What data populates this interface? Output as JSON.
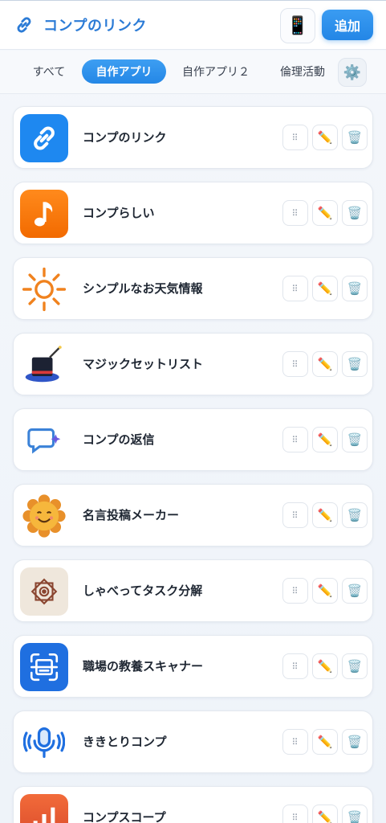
{
  "header": {
    "title": "コンプのリンク",
    "brand_icon": "link-icon",
    "device_icon": "mobile-phone-icon",
    "add_label": "追加"
  },
  "tabs": [
    {
      "label": "すべて",
      "active": false
    },
    {
      "label": "自作アプリ",
      "active": true
    },
    {
      "label": "自作アプリ２",
      "active": false
    },
    {
      "label": "倫理活動",
      "active": false
    }
  ],
  "tab_settings_icon": "gear-icon",
  "apps": [
    {
      "name": "コンプのリンク",
      "icon": "link-icon"
    },
    {
      "name": "コンプらしい",
      "icon": "music-note-icon"
    },
    {
      "name": "シンプルなお天気情報",
      "icon": "sun-icon"
    },
    {
      "name": "マジックセットリスト",
      "icon": "magic-hat-icon"
    },
    {
      "name": "コンプの返信",
      "icon": "chat-sparkle-icon"
    },
    {
      "name": "名言投稿メーカー",
      "icon": "smiling-flower-icon"
    },
    {
      "name": "しゃべってタスク分解",
      "icon": "ornament-icon"
    },
    {
      "name": "職場の教養スキャナー",
      "icon": "scanner-icon"
    },
    {
      "name": "ききとりコンプ",
      "icon": "microphone-icon"
    },
    {
      "name": "コンプスコープ",
      "icon": "bar-chart-icon"
    }
  ],
  "action_icons": {
    "drag": "drag-handle-icon",
    "edit": "pencil-icon",
    "delete": "trash-icon"
  },
  "colors": {
    "accent": "#2386e6",
    "brand_text": "#2b7bd6"
  }
}
